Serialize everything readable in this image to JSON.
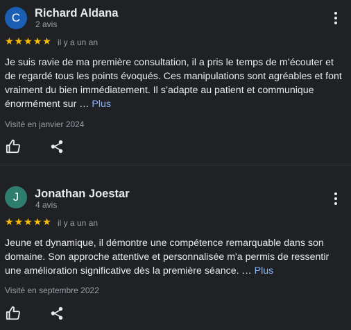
{
  "reviews": [
    {
      "avatar_letter": "C",
      "avatar_color": "#1a5fb4",
      "name": "Richard Aldana",
      "review_count": "2 avis",
      "stars": 5,
      "date": "il y a un an",
      "text": "Je suis ravie de ma première consultation, il a pris le temps de m’écouter et de regardé tous les points évoqués. Ces manipulations sont agréables et font vraiment du bien immédiatement. Il s’adapte au patient et communique énormément sur …",
      "more_label": "Plus",
      "visited": "Visité en janvier 2024"
    },
    {
      "avatar_letter": "J",
      "avatar_color": "#2f7d6d",
      "name": "Jonathan Joestar",
      "review_count": "4 avis",
      "stars": 5,
      "date": "il y a un an",
      "text": "Jeune et dynamique, il démontre une compétence remarquable dans son domaine. Son approche attentive et personnalisée m'a permis de ressentir une amélioration significative dès la première séance. …",
      "more_label": "Plus",
      "visited": "Visité en septembre 2022"
    }
  ],
  "icons": {
    "like": "thumbs-up-icon",
    "share": "share-icon",
    "menu": "more-vert-icon",
    "star": "star-icon"
  },
  "colors": {
    "background": "#202124",
    "star": "#fbbc04",
    "link": "#8ab4f8",
    "secondary_text": "#9aa0a6"
  }
}
